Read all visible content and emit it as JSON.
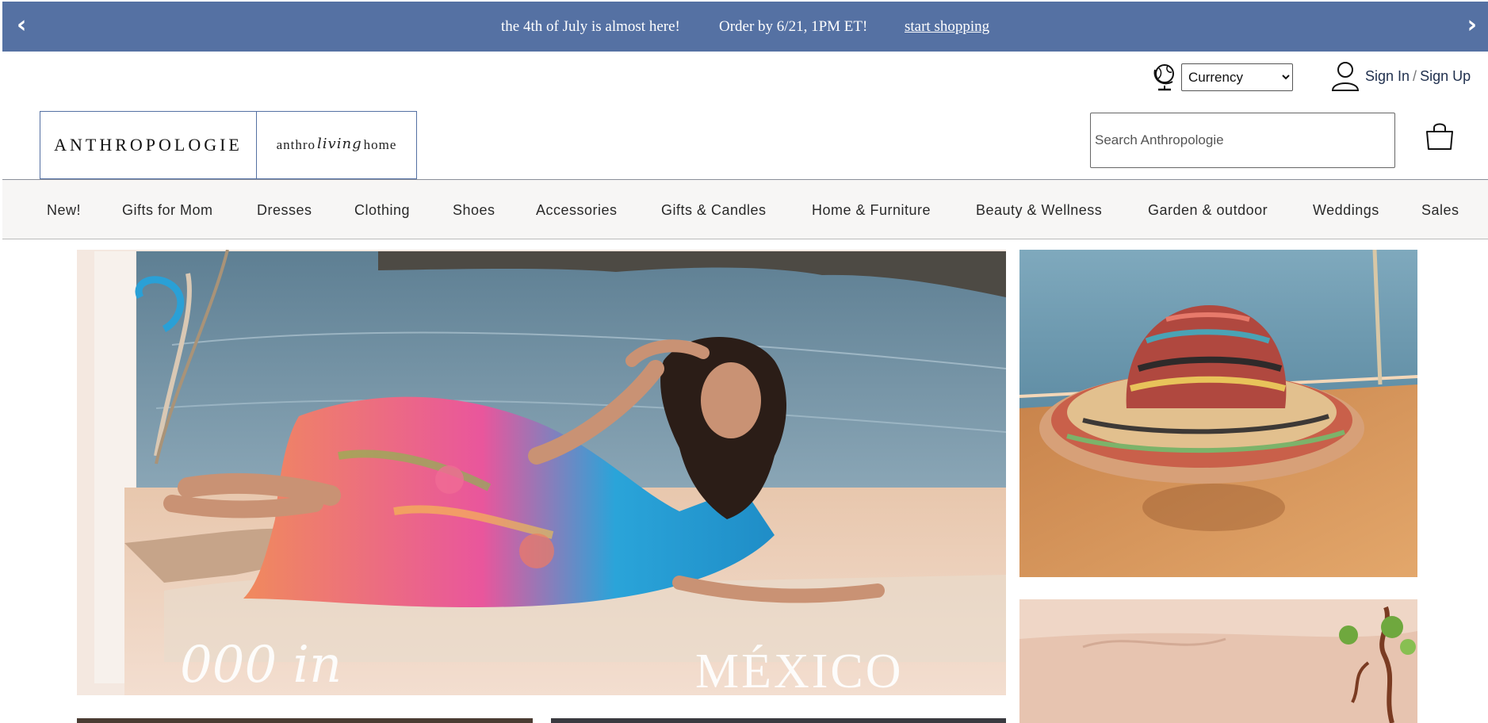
{
  "promo": {
    "prev_arrow": "‹",
    "next_arrow": "›",
    "message_1": "the 4th of July is almost here!",
    "message_2": "Order by 6/21, 1PM ET!",
    "link": "start shopping",
    "background_color": "#5571a3"
  },
  "utility": {
    "globe_icon": "globe-icon",
    "currency_selected": "Currency",
    "user_icon": "user-icon",
    "sign_in": "Sign In",
    "separator": "/",
    "sign_up": "Sign Up"
  },
  "logos": {
    "main": "ANTHROPOLOGIE",
    "home_prefix": "anthro",
    "home_script": "living",
    "home_suffix": "home"
  },
  "search": {
    "placeholder": "Search Anthropologie",
    "value": ""
  },
  "cart": {
    "icon": "shopping-bag-icon"
  },
  "nav": {
    "items": [
      {
        "label": "New!"
      },
      {
        "label": "Gifts for Mom"
      },
      {
        "label": "Dresses"
      },
      {
        "label": "Clothing"
      },
      {
        "label": "Shoes"
      },
      {
        "label": "Accessories"
      },
      {
        "label": "Gifts & Candles"
      },
      {
        "label": "Home & Furniture"
      },
      {
        "label": "Beauty & Wellness"
      },
      {
        "label": "Garden & outdoor"
      },
      {
        "label": "Weddings"
      },
      {
        "label": "Sales"
      }
    ]
  },
  "hero": {
    "caption_left": "000 in",
    "caption_right": "MÉXICO"
  }
}
